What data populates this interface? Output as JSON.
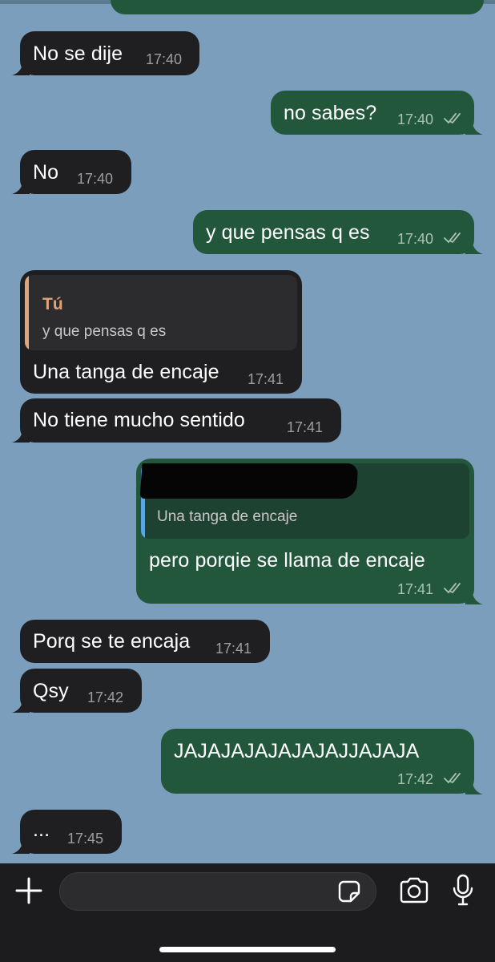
{
  "messages": [
    {
      "text": "No se dije",
      "time": "17:40"
    },
    {
      "text": "no sabes?",
      "time": "17:40"
    },
    {
      "text": "No",
      "time": "17:40"
    },
    {
      "text": "y que pensas q es",
      "time": "17:40"
    },
    {
      "reply_name": "Tú",
      "reply_text": "y que pensas q es",
      "text": "Una tanga de encaje",
      "time": "17:41"
    },
    {
      "text": "No tiene mucho sentido",
      "time": "17:41"
    },
    {
      "reply_text": "Una tanga de encaje",
      "text": "pero porqie se llama de encaje",
      "time": "17:41"
    },
    {
      "text": "Porq se te encaja",
      "time": "17:41"
    },
    {
      "text": "Qsy",
      "time": "17:42"
    },
    {
      "text": "JAJAJAJAJAJAJAJJAJAJA",
      "time": "17:42"
    },
    {
      "text": "...",
      "time": "17:45"
    }
  ],
  "colors": {
    "background": "#7b9ebd",
    "incoming_bubble": "#1f1f21",
    "outgoing_bubble": "#22573b",
    "reply_name_accent": "#e0a47a",
    "reply_bar_incoming": "#e0a47a",
    "reply_bar_outgoing": "#5ea4e0"
  },
  "icons": {
    "attach": "plus-icon",
    "sticker": "sticker-icon",
    "camera": "camera-icon",
    "voice": "microphone-icon"
  }
}
